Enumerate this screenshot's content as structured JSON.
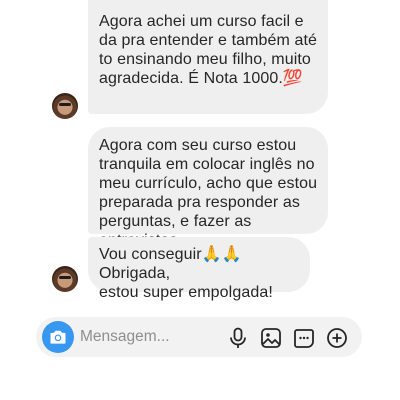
{
  "messages": [
    {
      "text": "Agora achei um curso facil e\nda pra entender e também até\nto ensinando meu filho, muito\nagradecida. É Nota 1000.💯",
      "avatar_icon": "profile-photo"
    },
    {
      "text": "Agora com seu curso estou\ntranquila em colocar inglês no\nmeu currículo, acho que estou\npreparada pra responder as\nperguntas, e fazer as entrevistas"
    },
    {
      "text": "Vou conseguir🙏🙏Obrigada,\nestou super empolgada!",
      "avatar_icon": "profile-photo"
    }
  ],
  "composer": {
    "placeholder": "Mensagem...",
    "value": "",
    "icons": [
      "camera-icon",
      "microphone-icon",
      "gallery-icon",
      "sticker-icon",
      "plus-icon"
    ]
  },
  "colors": {
    "bubble": "#efefef",
    "text": "#262626",
    "accent": "#3897f0",
    "placeholder": "#8e8e8e"
  }
}
